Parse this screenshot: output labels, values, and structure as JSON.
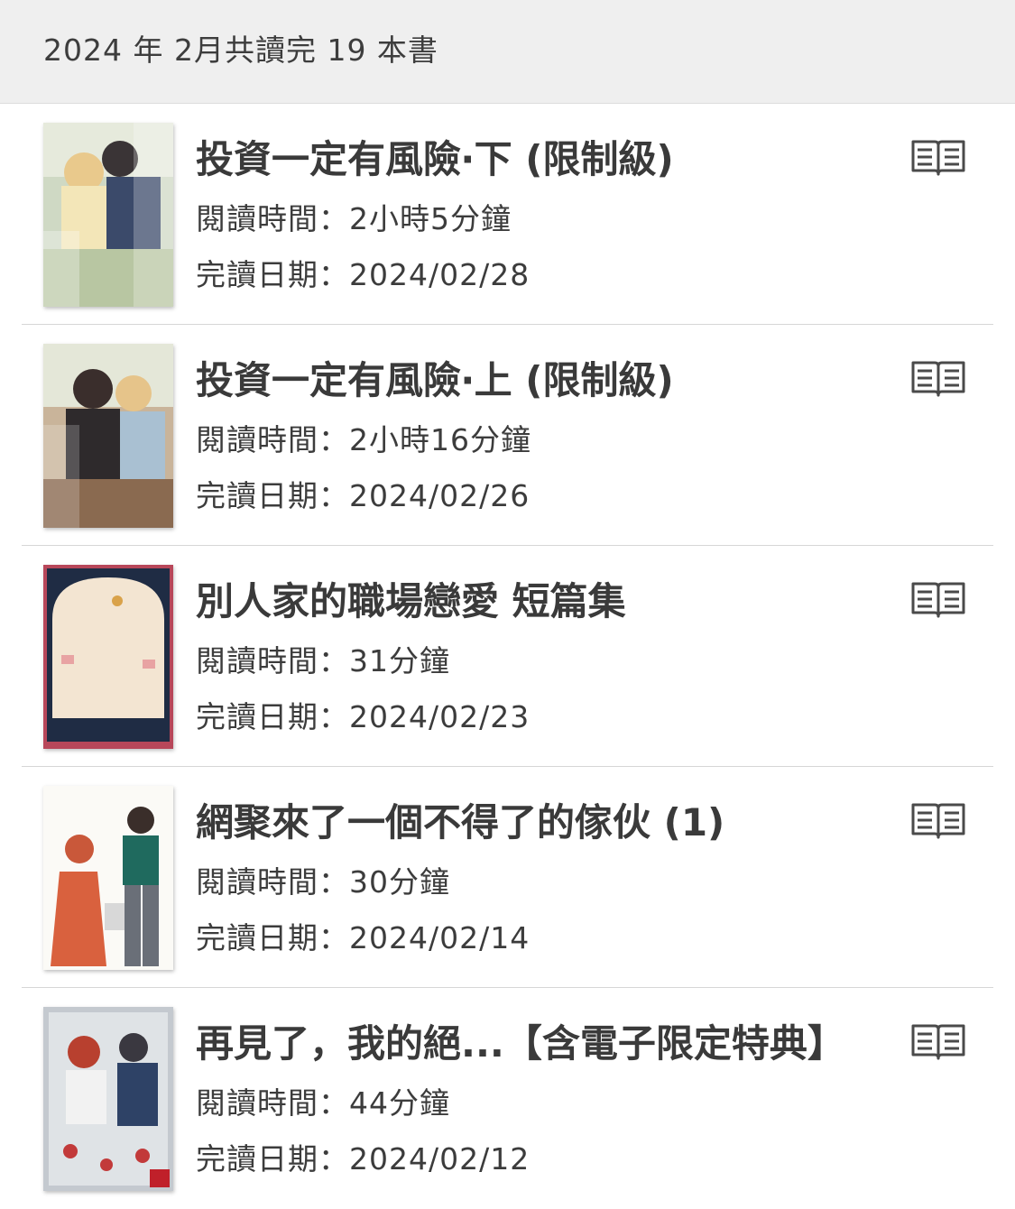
{
  "header": {
    "summary": "2024 年 2月共讀完 19 本書"
  },
  "books": [
    {
      "title": "投資一定有風險‧下 (限制級)",
      "time_label": "閱讀時間：",
      "time": "2小時5分鐘",
      "date_label": "完讀日期：",
      "date": "2024/02/28",
      "icon": "open-book-icon"
    },
    {
      "title": "投資一定有風險‧上 (限制級)",
      "time_label": "閱讀時間：",
      "time": "2小時16分鐘",
      "date_label": "完讀日期：",
      "date": "2024/02/26",
      "icon": "open-book-icon"
    },
    {
      "title": "別人家的職場戀愛 短篇集",
      "time_label": "閱讀時間：",
      "time": "31分鐘",
      "date_label": "完讀日期：",
      "date": "2024/02/23",
      "icon": "open-book-icon"
    },
    {
      "title": "網聚來了一個不得了的傢伙 (1)",
      "time_label": "閱讀時間：",
      "time": "30分鐘",
      "date_label": "完讀日期：",
      "date": "2024/02/14",
      "icon": "open-book-icon"
    },
    {
      "title": "再見了，我的絕...【含電子限定特典】",
      "time_label": "閱讀時間：",
      "time": "44分鐘",
      "date_label": "完讀日期：",
      "date": "2024/02/12",
      "icon": "open-book-icon"
    }
  ],
  "colors": {
    "header_bg": "#efefef",
    "text": "#3a3a3a",
    "divider": "#d6d6d6"
  }
}
